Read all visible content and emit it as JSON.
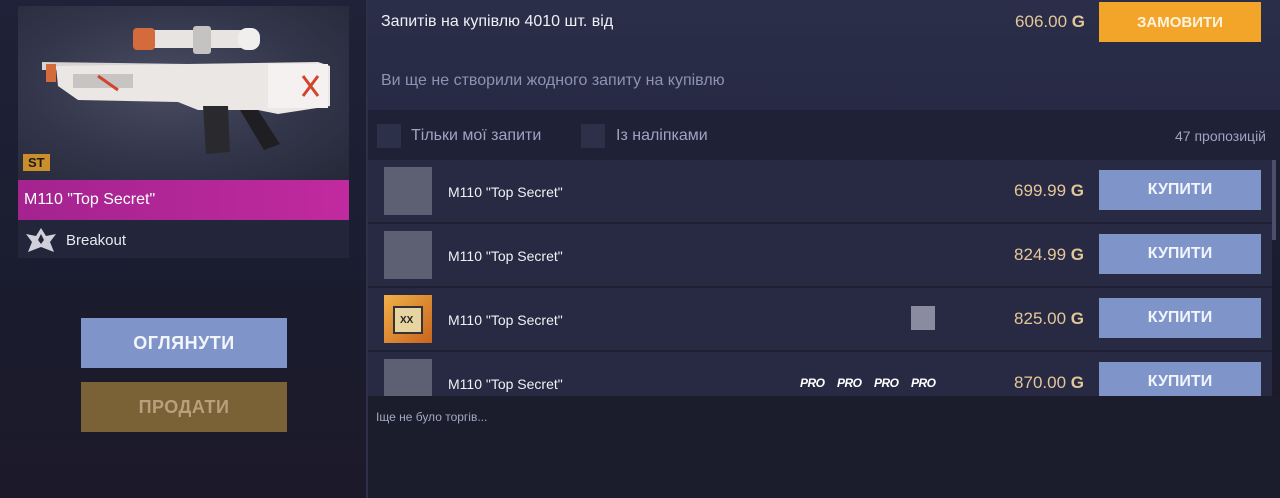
{
  "item": {
    "grade_badge": "ST",
    "name": "M110 \"Top Secret\"",
    "collection": "Breakout",
    "collection_logo_text": "BREAKOUT"
  },
  "actions": {
    "inspect_label": "ОГЛЯНУТИ",
    "sell_label": "ПРОДАТИ"
  },
  "currency_symbol": "G",
  "buy_orders": {
    "title": "Запитів на купівлю 4010 шт. від",
    "price": "606.00",
    "order_button": "ЗАМОВИТИ",
    "empty_message": "Ви ще не створили жодного запиту на купівлю"
  },
  "filters": {
    "my_orders_label": "Тільки мої запити",
    "with_stickers_label": "Із наліпками",
    "offers_count": "47 пропозицій"
  },
  "listings": [
    {
      "title": "M110 \"Top Secret\"",
      "price": "699.99",
      "button": "КУПИТИ",
      "stickers": []
    },
    {
      "title": "M110 \"Top Secret\"",
      "price": "824.99",
      "button": "КУПИТИ",
      "stickers": []
    },
    {
      "title": "M110 \"Top Secret\"",
      "price": "825.00",
      "button": "КУПИТИ",
      "stickers": [
        "avatar"
      ]
    },
    {
      "title": "M110 \"Top Secret\"",
      "price": "870.00",
      "button": "КУПИТИ",
      "stickers": [
        "PRO",
        "PRO",
        "PRO",
        "PRO"
      ]
    }
  ],
  "trades_message": "Іще не було торгів...",
  "colors": {
    "accent_order": "#f3a52a",
    "accent_buy": "#7f95c9",
    "rarity_bar": "#b3279a",
    "price_text": "#e3c69a"
  }
}
